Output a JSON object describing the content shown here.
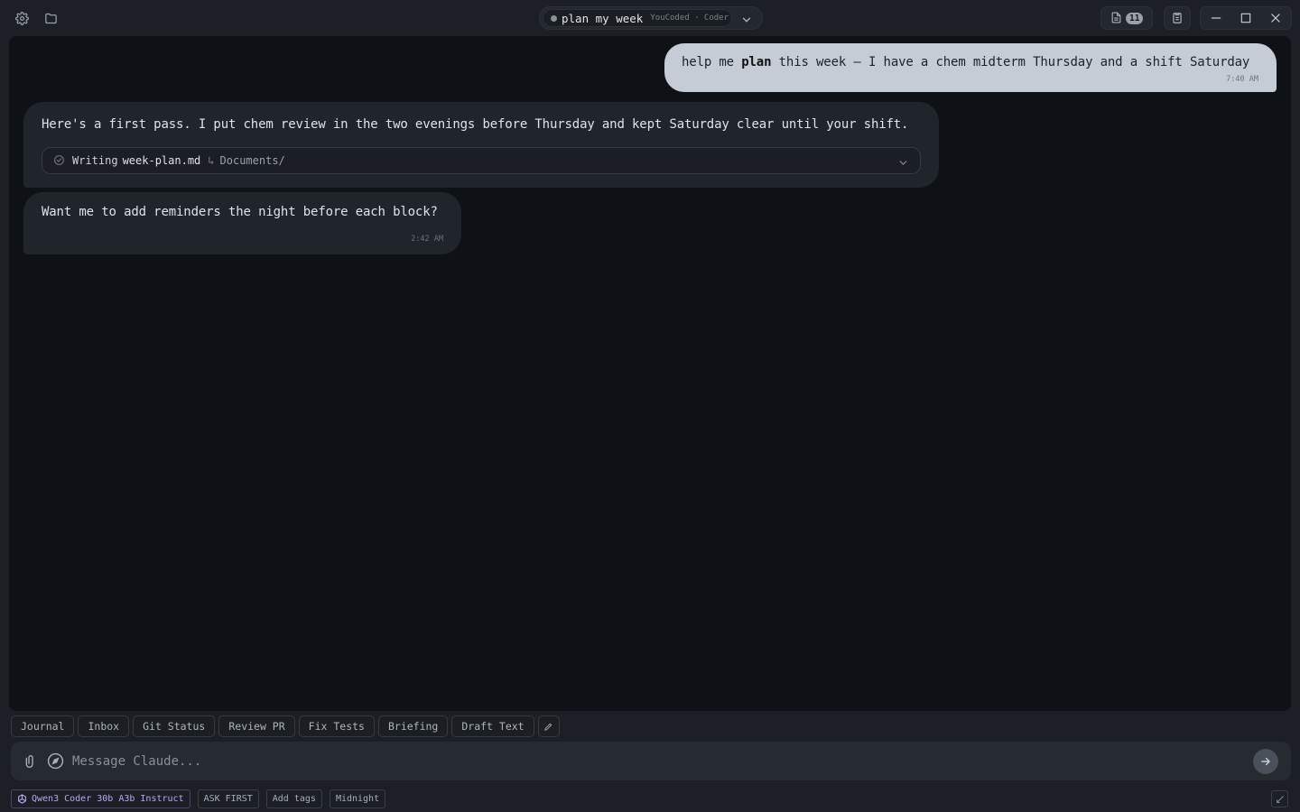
{
  "titlebar": {
    "session_name": "plan my week",
    "session_meta": "YouCoded · Coder",
    "doc_count": "11"
  },
  "messages": {
    "user": {
      "before": "help me ",
      "bold": "plan",
      "after": " this week — I have a chem midterm Thursday and a shift Saturday",
      "time": "7:40 AM"
    },
    "assistant_1": {
      "text": "Here's a first pass. I put chem review in the two evenings before Thursday and kept Saturday clear until your shift.",
      "tool": {
        "verb": "Writing",
        "file": "week-plan.md",
        "arrow": "↳",
        "dir": "Documents/"
      }
    },
    "assistant_2": {
      "text": "Want me to add reminders the night before each block?",
      "time": "2:42 AM"
    }
  },
  "chips": [
    "Journal",
    "Inbox",
    "Git Status",
    "Review PR",
    "Fix Tests",
    "Briefing",
    "Draft Text"
  ],
  "composer": {
    "placeholder": "Message Claude..."
  },
  "status": {
    "model": "Qwen3 Coder 30b A3b Instruct",
    "permission": "ASK FIRST",
    "tags": "Add tags",
    "theme": "Midnight"
  },
  "icons": {
    "settings": "gear-icon",
    "folder": "folder-icon",
    "chevron": "chevron-down-icon",
    "document": "document-icon",
    "memory": "clipboard-icon",
    "minimize": "minimize-icon",
    "maximize": "maximize-icon",
    "close": "close-icon",
    "attach": "paperclip-icon",
    "compass": "compass-icon",
    "send": "arrow-right-icon",
    "edit": "pencil-icon",
    "model": "model-logo-icon",
    "expand": "expand-icon"
  },
  "colors": {
    "background": "#1c2026",
    "chat_bg": "#0e1116",
    "user_bubble": "#c5ccd5",
    "assistant_bubble": "#20252c",
    "model_accent": "#b8a8f0"
  }
}
